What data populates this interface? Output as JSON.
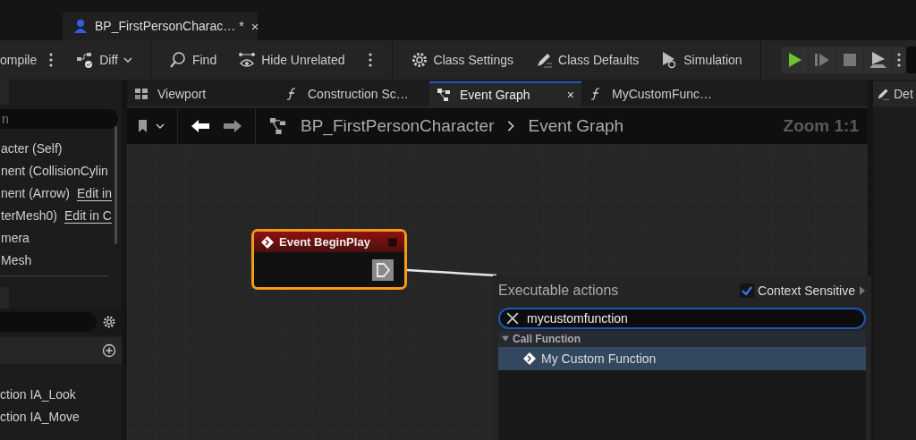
{
  "document_tab": {
    "title": "BP_FirstPersonCharac…",
    "modified_mark": "*",
    "close": "×"
  },
  "toolbar": {
    "compile_label": "ompile",
    "buttons": [
      {
        "label": "Diff",
        "kind": "diff"
      },
      {
        "label": "Find",
        "kind": "find"
      },
      {
        "label": "Hide Unrelated",
        "kind": "hide"
      },
      {
        "label": "Class Settings",
        "kind": "settings"
      },
      {
        "label": "Class Defaults",
        "kind": "defaults"
      },
      {
        "label": "Simulation",
        "kind": "simulation"
      }
    ]
  },
  "editor_tabs": [
    {
      "label": "Viewport",
      "kind": "viewport",
      "selected": false
    },
    {
      "label": "Construction Sc…",
      "kind": "function",
      "selected": false
    },
    {
      "label": "Event Graph",
      "kind": "graph",
      "selected": true,
      "close": "×"
    },
    {
      "label": "MyCustomFunc…",
      "kind": "function",
      "selected": false
    }
  ],
  "details_tab": {
    "label": "Det"
  },
  "components": {
    "search_placeholder": "n",
    "items": [
      {
        "label": "acter (Self)"
      },
      {
        "label": "nent (CollisionCylin"
      },
      {
        "label": "nent (Arrow)",
        "link": "Edit in"
      },
      {
        "label": "terMesh0)",
        "link": "Edit in C"
      },
      {
        "label": "mera"
      },
      {
        "label": "Mesh"
      }
    ]
  },
  "my_blueprint": {
    "items": [
      "ction IA_Look",
      "ction IA_Move"
    ]
  },
  "breadcrumb": {
    "items": [
      "BP_FirstPersonCharacter",
      "Event Graph"
    ],
    "zoom": "Zoom 1:1"
  },
  "node": {
    "title": "Event BeginPlay",
    "selected": true
  },
  "action_menu": {
    "title": "Executable actions",
    "context_sensitive": {
      "label": "Context Sensitive",
      "checked": true
    },
    "search_value": "mycustomfunction",
    "categories": [
      {
        "label": "Call Function",
        "expanded": true,
        "children": [
          {
            "label": "My Custom Function",
            "selected": true
          }
        ]
      }
    ]
  }
}
